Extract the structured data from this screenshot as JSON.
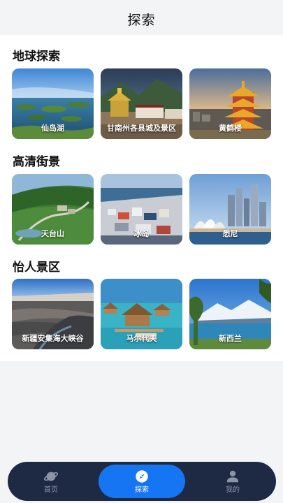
{
  "header": {
    "title": "探索"
  },
  "sections": [
    {
      "title": "地球探索",
      "cards": [
        {
          "label": "仙岛湖",
          "scene": "lake"
        },
        {
          "label": "甘南州各县城及景区",
          "scene": "temple"
        },
        {
          "label": "黄鹤楼",
          "scene": "tower"
        }
      ]
    },
    {
      "title": "高清街景",
      "cards": [
        {
          "label": "天台山",
          "scene": "mountain"
        },
        {
          "label": "冰岛",
          "scene": "harbor"
        },
        {
          "label": "悉尼",
          "scene": "sydney"
        }
      ]
    },
    {
      "title": "怡人景区",
      "cards": [
        {
          "label": "新疆安集海大峡谷",
          "scene": "canyon"
        },
        {
          "label": "马尔代夫",
          "scene": "maldives"
        },
        {
          "label": "新西兰",
          "scene": "newzealand"
        }
      ]
    }
  ],
  "tabbar": {
    "tabs": [
      {
        "label": "首页",
        "icon": "planet-icon",
        "active": false
      },
      {
        "label": "探索",
        "icon": "compass-icon",
        "active": true
      },
      {
        "label": "我的",
        "icon": "user-icon",
        "active": false
      }
    ]
  },
  "colors": {
    "accent": "#1575f3",
    "tabbar": "#1e2a44",
    "background": "#f3f4f6"
  }
}
